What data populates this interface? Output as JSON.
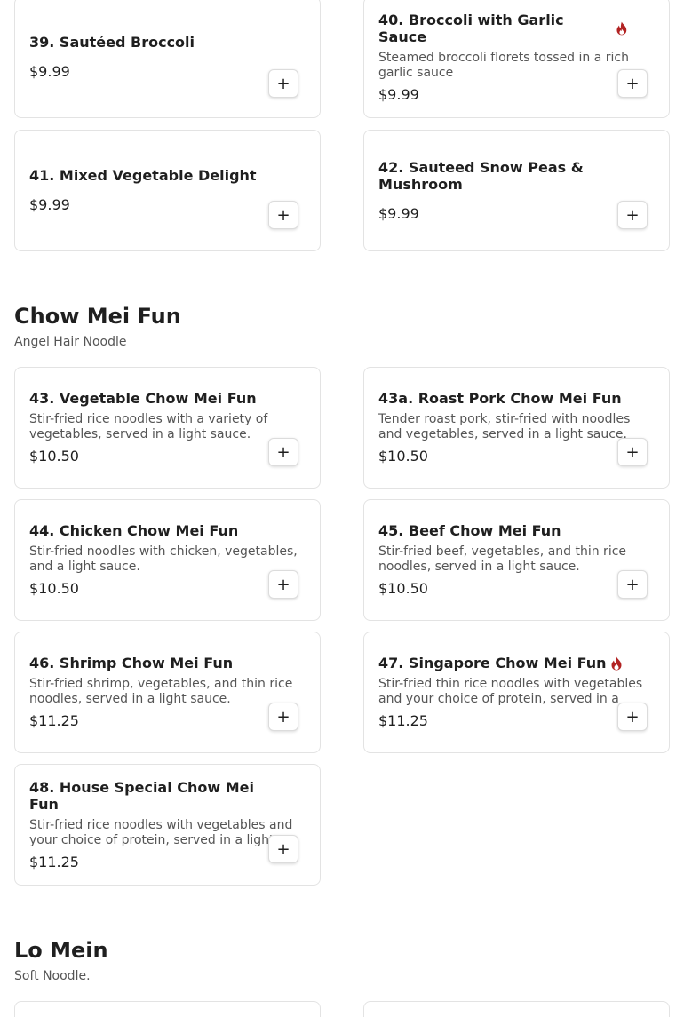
{
  "colors": {
    "fire": "#b22222",
    "border": "#e3e3e3",
    "text": "#1f1f1f",
    "muted": "#555555"
  },
  "add_label": "+",
  "vegetables": {
    "items": [
      {
        "name": "39. Sautéed Broccoli",
        "desc": "",
        "price": "$9.99",
        "spicy": false
      },
      {
        "name": "40. Broccoli with Garlic Sauce",
        "desc": "Steamed broccoli florets tossed in a rich garlic sauce",
        "price": "$9.99",
        "spicy": true
      },
      {
        "name": "41. Mixed Vegetable Delight",
        "desc": "",
        "price": "$9.99",
        "spicy": false
      },
      {
        "name": "42. Sauteed Snow Peas & Mushroom",
        "desc": "",
        "price": "$9.99",
        "spicy": false
      }
    ]
  },
  "chow_mei_fun": {
    "title": "Chow Mei Fun",
    "subtitle": "Angel Hair Noodle",
    "items": [
      {
        "name": "43. Vegetable Chow Mei Fun",
        "desc": "Stir-fried rice noodles with a variety of vegetables, served in a light sauce.",
        "price": "$10.50",
        "spicy": false
      },
      {
        "name": "43a. Roast Pork Chow Mei Fun",
        "desc": "Tender roast pork, stir-fried with noodles and vegetables, served in a light sauce.",
        "price": "$10.50",
        "spicy": false
      },
      {
        "name": "44. Chicken Chow Mei Fun",
        "desc": "Stir-fried noodles with chicken, vegetables, and a light sauce.",
        "price": "$10.50",
        "spicy": false
      },
      {
        "name": "45. Beef Chow Mei Fun",
        "desc": "Stir-fried beef, vegetables, and thin rice noodles, served in a light sauce.",
        "price": "$10.50",
        "spicy": false
      },
      {
        "name": "46. Shrimp Chow Mei Fun",
        "desc": "Stir-fried shrimp, vegetables, and thin rice noodles, served in a light sauce.",
        "price": "$11.25",
        "spicy": false
      },
      {
        "name": "47. Singapore Chow Mei Fun",
        "desc": "Stir-fried thin rice noodles with vegetables and your choice of protein, served in a light sauce.",
        "price": "$11.25",
        "spicy": true
      },
      {
        "name": "48. House Special Chow Mei Fun",
        "desc": "Stir-fried rice noodles with vegetables and your choice of protein, served in a light sauce.",
        "price": "$11.25",
        "spicy": false
      }
    ]
  },
  "lo_mein": {
    "title": "Lo Mein",
    "subtitle": "Soft Noodle."
  }
}
